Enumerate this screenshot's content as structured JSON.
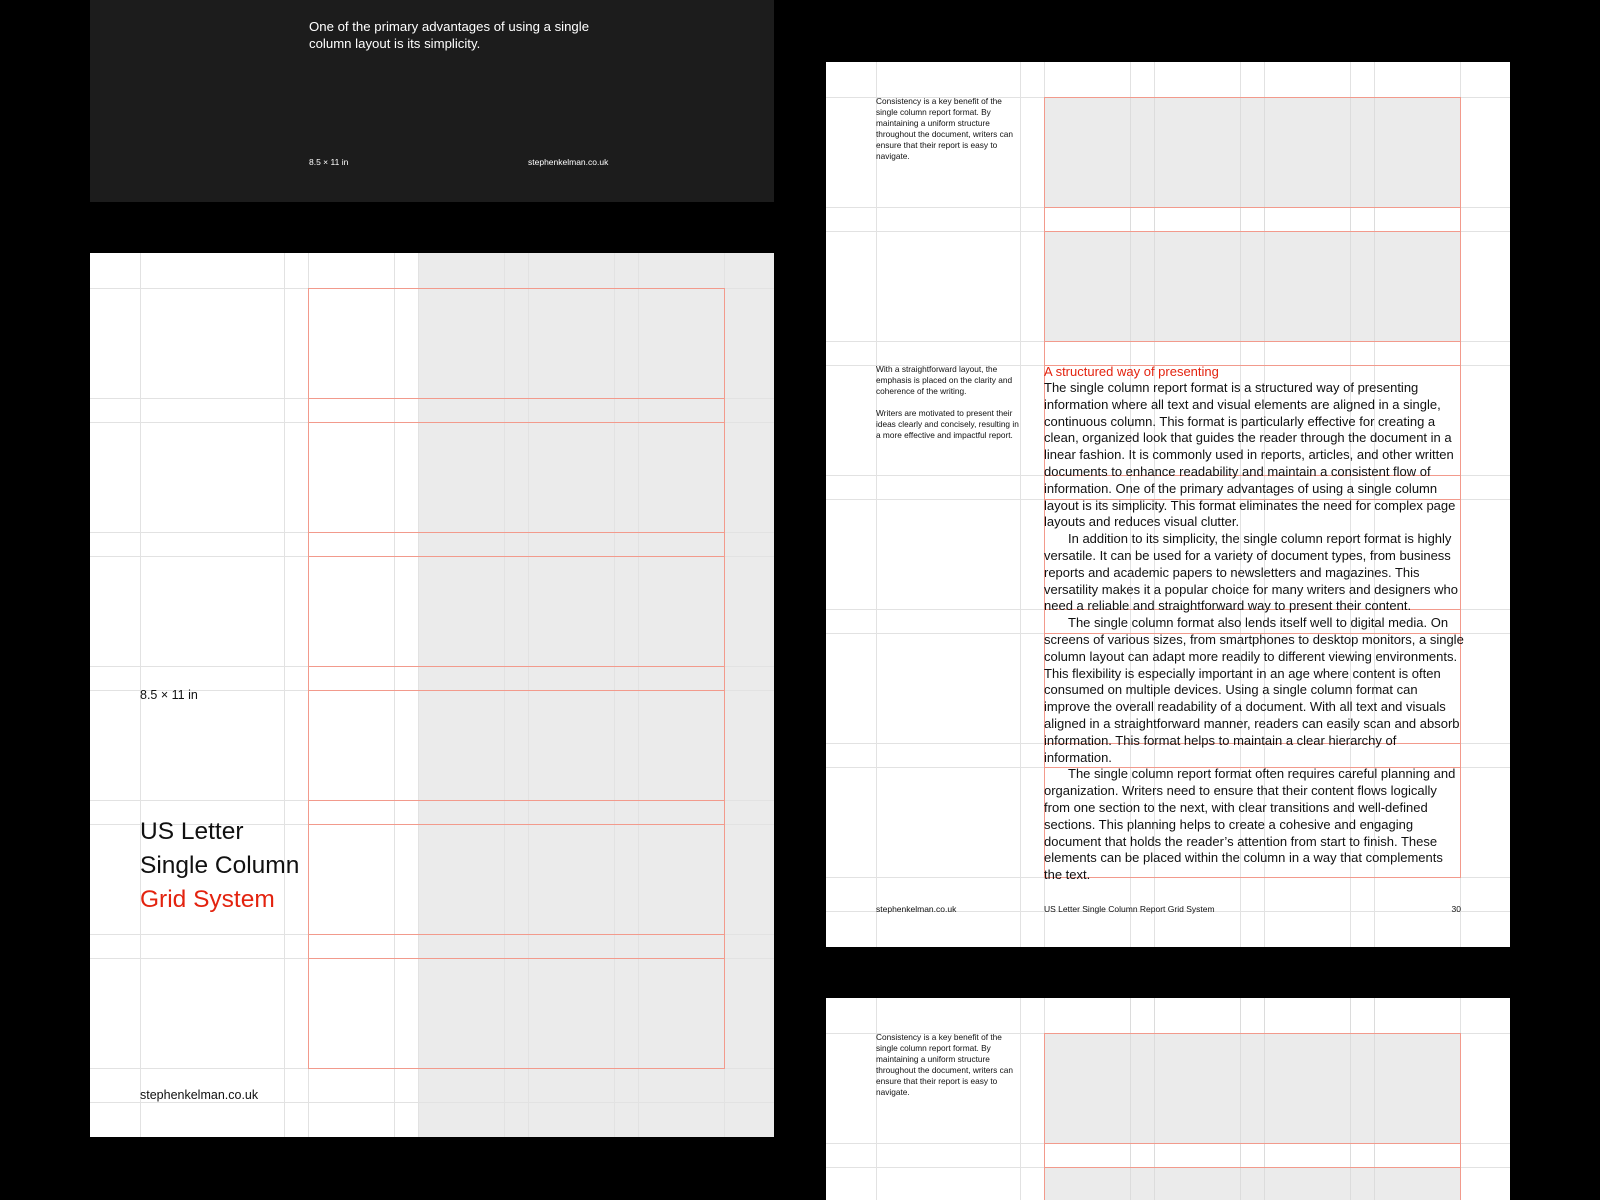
{
  "colors": {
    "accent_red": "#e3230f",
    "dark_page": "#1c1c1c",
    "background": "#000000",
    "grey_fill": "#ebebeb"
  },
  "dark_page": {
    "quote": "One of the primary advantages of using a single column layout is its simplicity.",
    "size_label": "8.5 × 11 in",
    "url": "stephenkelman.co.uk"
  },
  "cover_page": {
    "size_label": "8.5 × 11 in",
    "title_line1": "US Letter",
    "title_line2": "Single Column",
    "title_line3": "Grid System",
    "url": "stephenkelman.co.uk"
  },
  "content_page": {
    "sidenote_top": "Consistency is a key benefit of the single column report format. By maintaining a uniform structure throughout the document, writers can ensure that their report is easy to navigate.",
    "sidenote_mid_1": "With a straightforward layout, the emphasis is placed on the clarity and coherence of the writing.",
    "sidenote_mid_2": "Writers are motivated to present their ideas clearly and concisely, resulting in a more effective and impactful report.",
    "heading": "A structured way of presenting",
    "paragraphs": [
      "The single column report format is a structured way of presenting information where all text and visual elements are aligned in a single, continuous column. This format is particularly effective for creating a clean, organized look that guides the reader through the document in a linear fashion. It is commonly used in reports, articles, and other written documents to enhance readability and maintain a consistent flow of information. One of the primary advantages of using a single column layout is its simplicity. This format eliminates the need for complex page layouts and reduces visual clutter.",
      "In addition to its simplicity, the single column report format is highly versatile. It can be used for a variety of document types, from business reports and academic papers to newsletters and magazines. This versatility makes it a popular choice for many writers and designers who need a reliable and straightforward way to present their content.",
      "The single column format also lends itself well to digital media. On screens of various sizes, from smartphones to desktop monitors, a single column layout can adapt more readily to different viewing environments. This flexibility is especially important in an age where content is often consumed on multiple devices. Using a single column format can improve the overall readability of a document. With all text and visuals aligned in a straightforward manner, readers can easily scan and absorb information. This format helps to maintain a clear hierarchy of information.",
      "The single column report format often requires careful planning and organization. Writers need to ensure that their content flows logically from one section to the next, with clear transitions and well-defined sections. This planning helps to create a cohesive and engaging document that holds the reader’s attention from start to finish. These elements can be placed within the column in a way that complements the text."
    ],
    "footer_url": "stephenkelman.co.uk",
    "footer_title": "US Letter Single Column Report Grid System",
    "page_number": "30"
  },
  "bottom_page": {
    "sidenote_top": "Consistency is a key benefit of the single column report format. By maintaining a uniform structure throughout the document, writers can ensure that their report is easy to navigate."
  }
}
